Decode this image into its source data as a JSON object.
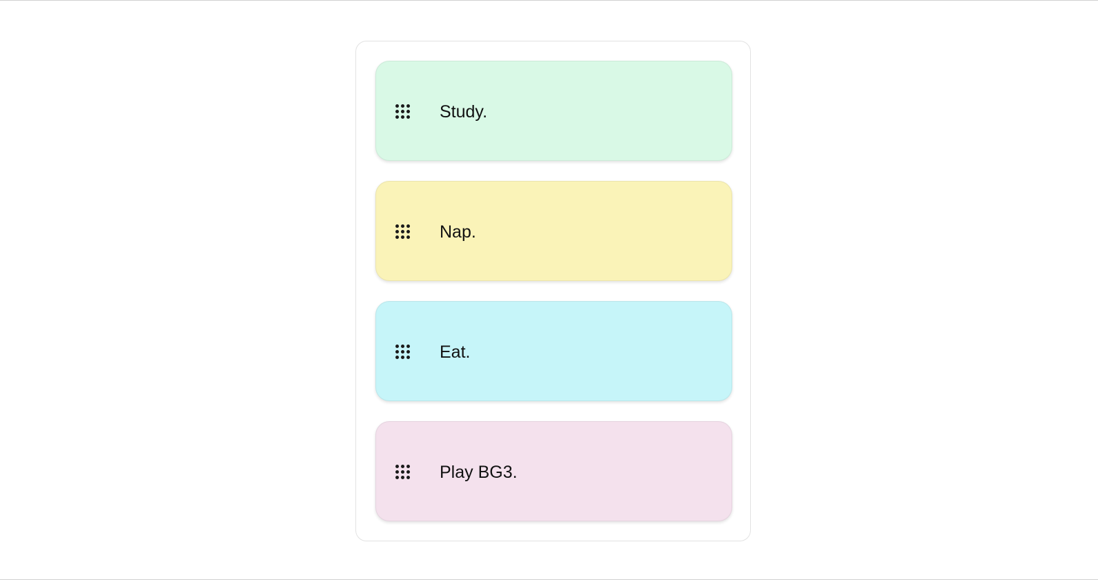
{
  "tasks": [
    {
      "label": "Study.",
      "color": "#d9f9e6"
    },
    {
      "label": "Nap.",
      "color": "#faf3b8"
    },
    {
      "label": "Eat.",
      "color": "#c6f5f9"
    },
    {
      "label": "Play BG3.",
      "color": "#f4e1ed"
    }
  ],
  "handle_icon": "drag-grid-icon"
}
